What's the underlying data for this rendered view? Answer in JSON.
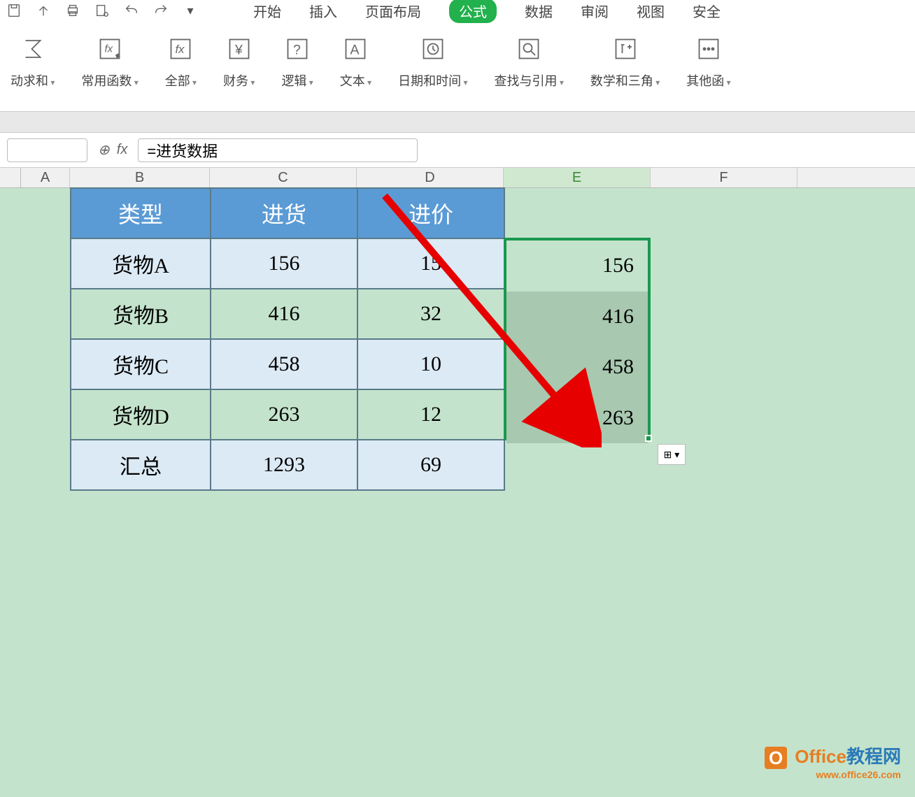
{
  "tabs": {
    "start": "开始",
    "insert": "插入",
    "layout": "页面布局",
    "formula": "公式",
    "data": "数据",
    "review": "审阅",
    "view": "视图",
    "security": "安全"
  },
  "ribbon": {
    "autosum": "动求和",
    "common": "常用函数",
    "all": "全部",
    "finance": "财务",
    "logic": "逻辑",
    "text": "文本",
    "datetime": "日期和时间",
    "lookup": "查找与引用",
    "math": "数学和三角",
    "other": "其他函"
  },
  "formula_bar": {
    "fx_label": "fx",
    "formula": "=进货数据"
  },
  "columns": {
    "A": "A",
    "B": "B",
    "C": "C",
    "D": "D",
    "E": "E",
    "F": "F"
  },
  "table": {
    "headers": {
      "type": "类型",
      "stock": "进货",
      "price": "进价"
    },
    "rows": [
      {
        "name": "货物A",
        "stock": "156",
        "price": "15"
      },
      {
        "name": "货物B",
        "stock": "416",
        "price": "32"
      },
      {
        "name": "货物C",
        "stock": "458",
        "price": "10"
      },
      {
        "name": "货物D",
        "stock": "263",
        "price": "12"
      }
    ],
    "total": {
      "label": "汇总",
      "stock": "1293",
      "price": "69"
    }
  },
  "selection": [
    "156",
    "416",
    "458",
    "263"
  ],
  "watermark": {
    "logo": "O",
    "text1": "Office",
    "text2": "教程网",
    "url": "www.office26.com"
  }
}
